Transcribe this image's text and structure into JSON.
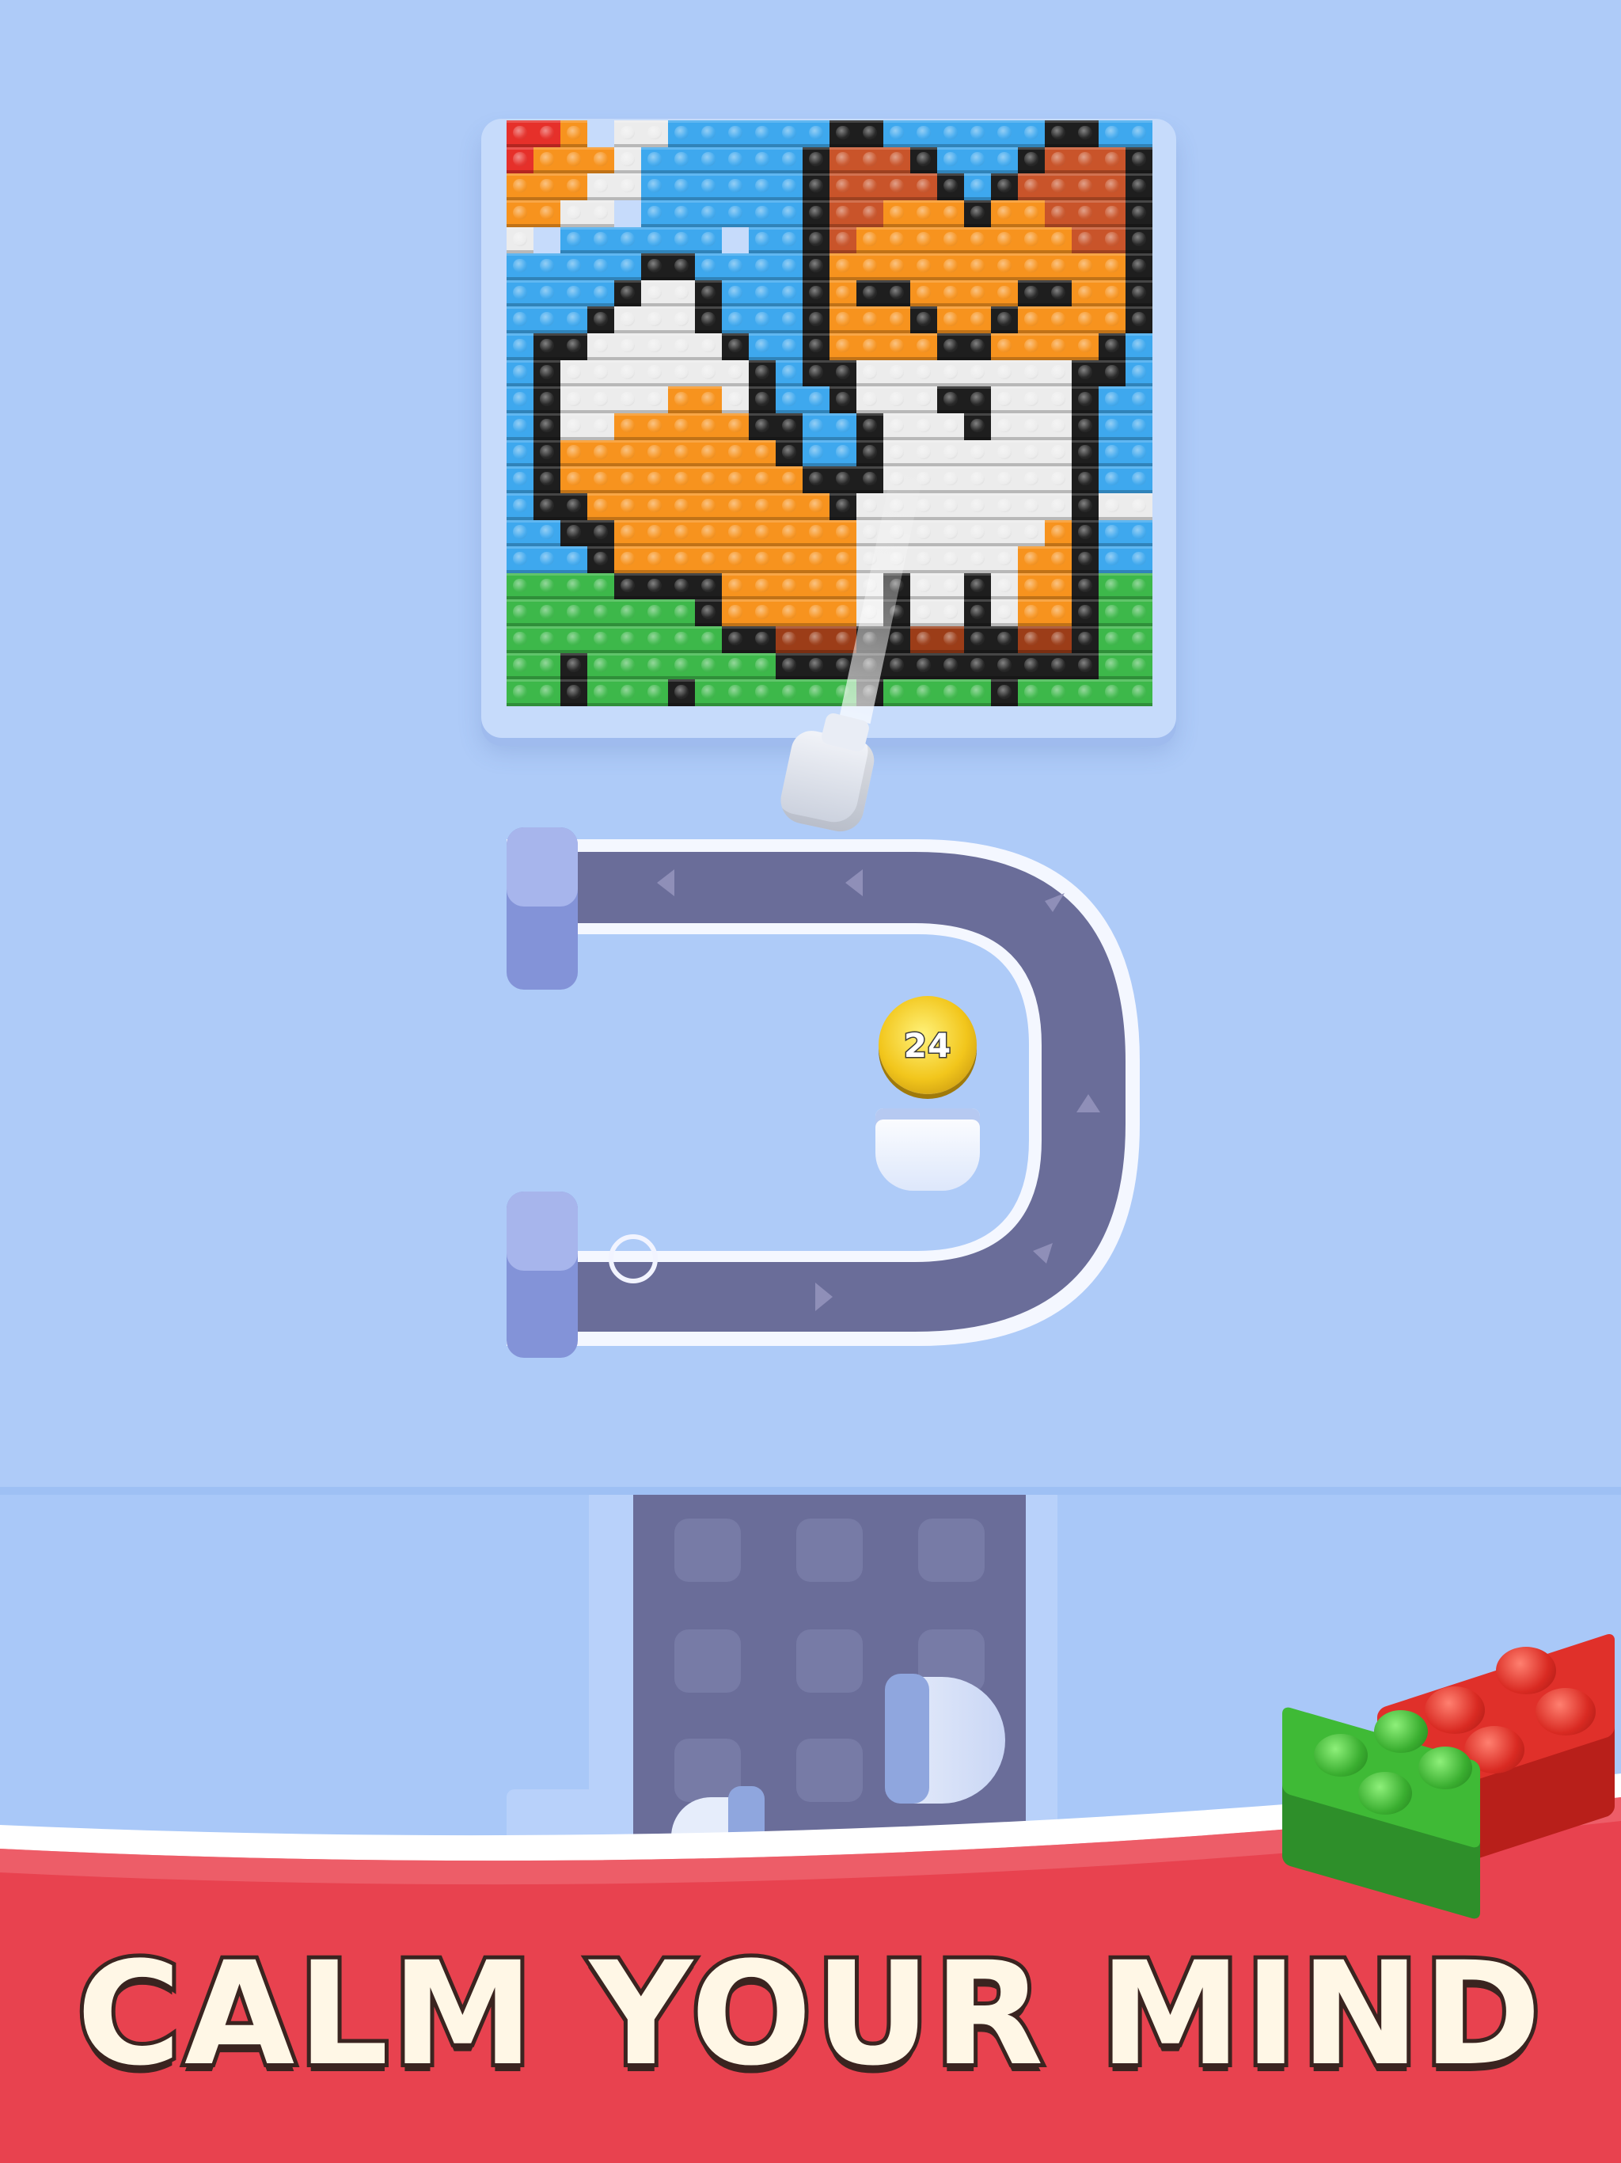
{
  "banner": {
    "text": "CALM YOUR MIND"
  },
  "coin": {
    "value": "24"
  },
  "colors": {
    "background": "#aecbf8",
    "track": "#6a6d99",
    "banner_red": "#e8424f",
    "banner_white_band": "#ffffff",
    "text_fill": "#fff7e6",
    "text_stroke": "#3a2420"
  },
  "pixel_art": {
    "subject": "fox",
    "palette": {
      "K": "#1e1e1e",
      "B": "#3ea8ee",
      "W": "#ececec",
      "O": "#f7931e",
      "D": "#c9542a",
      "G": "#3db84a",
      "R": "#e6302a",
      "N": "#9c3d18",
      "_": "empty"
    },
    "rows": [
      "RRO_WWBBBBBBKKBBBBBBKKBB",
      "ROOOWBBBBBBKDDDKBBBKDDDK",
      "OOOWWBBBBBBKDDDDKBKDDDDK",
      "OOWW_BBBBBBKDDOOOKOODDDK",
      "W_BBBBBB_BBKDOOOOOOOODDK",
      "BBBBBKKBBBBKOOOOOOOOOOOK",
      "BBBBKWWKBBBKOKKOOOOKKOOK",
      "BBBKWWWKBBBKOOOKOOKOOOOK",
      "BKKWWWWWKBBKOOOOKKOOOOKB",
      "BKWWWWWWWKBKKWWWWWWWWKKB",
      "BKWWWWOOWKBBKWWWKKWWWKBB",
      "BKWWOOOOOKKBBKWWWKWWWKBB",
      "BKOOOOOOOOKBBKWWWWWWWKBB",
      "BKOOOOOOOOOKKKWWWWWWWKBB",
      "BKKOOOOOOOOOKWWWWWWWWKWW",
      "BBKKOOOOOOOOOWWWWWWWOKBB",
      "BBBKOOOOOOOOOWWWWWWOOKBB",
      "GGGGKKKKOOOOOWKWWKWOOKGG",
      "GGGGGGGKOOOOOWKWWKWOOKGG",
      "GGGGGGGGKKNNNKKNNKKNNKGG",
      "GGKGGGGGGGKKKKKKKKKKKKGG",
      "GGKGGGKGGGGGGKGGGGKGGGGG"
    ]
  }
}
